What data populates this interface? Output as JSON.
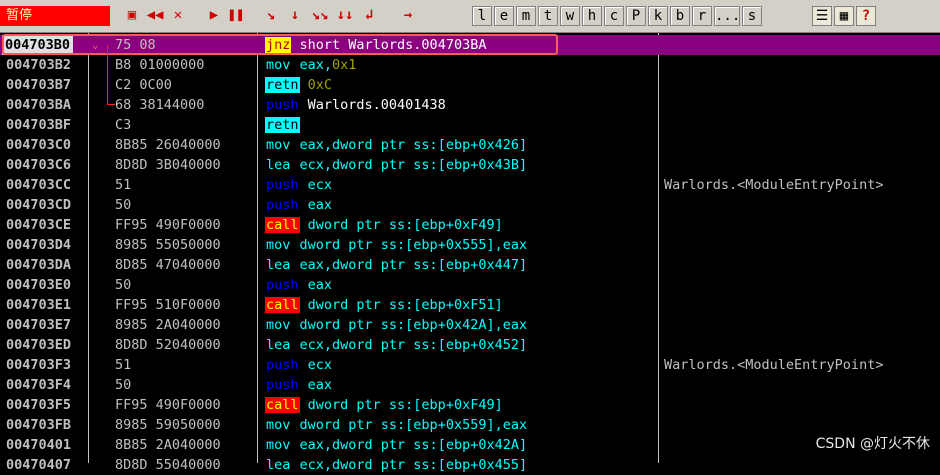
{
  "status": "暂停",
  "toolbar": {
    "buttons": [
      {
        "label": "▣",
        "name": "open-icon"
      },
      {
        "label": "◀◀",
        "name": "restart-icon"
      },
      {
        "label": "✕",
        "name": "close-icon"
      },
      {
        "label": "▶",
        "name": "run-icon"
      },
      {
        "label": "❚❚",
        "name": "pause-icon"
      },
      {
        "label": "↘",
        "name": "step-into-icon"
      },
      {
        "label": "↓",
        "name": "step-over-icon"
      },
      {
        "label": "↘↘",
        "name": "trace-into-icon"
      },
      {
        "label": "↓↓",
        "name": "trace-over-icon"
      },
      {
        "label": "↲",
        "name": "execute-till-return-icon"
      },
      {
        "label": "→",
        "name": "goto-icon"
      }
    ],
    "letters": [
      "l",
      "e",
      "m",
      "t",
      "w",
      "h",
      "c",
      "P",
      "k",
      "b",
      "r",
      "...",
      "s"
    ],
    "right_icons": [
      {
        "label": "☰",
        "name": "list-icon"
      },
      {
        "label": "▦",
        "name": "grid-icon"
      },
      {
        "label": "?",
        "name": "help-icon"
      }
    ]
  },
  "rows": [
    {
      "addr": "004703B0",
      "marker": "⌄",
      "hex": "75 08",
      "mn": "jnz",
      "mt": "jmp",
      "ops": [
        {
          "t": " short Warlords.004703BA",
          "c": "op-w"
        }
      ],
      "cmt": "",
      "sel": true
    },
    {
      "addr": "004703B2",
      "hex": "B8 01000000",
      "mn": "mov",
      "mt": "plain",
      "ops": [
        {
          "t": " eax,",
          "c": "op"
        },
        {
          "t": "0x1",
          "c": "imm"
        }
      ],
      "cmt": ""
    },
    {
      "addr": "004703B7",
      "hex": "C2 0C00",
      "mn": "retn",
      "mt": "retn",
      "ops": [
        {
          "t": " 0xC",
          "c": "imm"
        }
      ],
      "cmt": ""
    },
    {
      "addr": "004703BA",
      "hex": "68 38144000",
      "mn": "push",
      "mt": "push",
      "ops": [
        {
          "t": " Warlords.00401438",
          "c": "op-w"
        }
      ],
      "cmt": ""
    },
    {
      "addr": "004703BF",
      "hex": "C3",
      "mn": "retn",
      "mt": "retn",
      "ops": [],
      "cmt": ""
    },
    {
      "addr": "004703C0",
      "hex": "8B85 26040000",
      "mn": "mov",
      "mt": "plain",
      "ops": [
        {
          "t": " eax,dword ptr ss:[ebp+0x426]",
          "c": "op"
        }
      ],
      "cmt": ""
    },
    {
      "addr": "004703C6",
      "hex": "8D8D 3B040000",
      "mn": "lea",
      "mt": "plain",
      "ops": [
        {
          "t": " ecx,dword ptr ss:[ebp+0x43B]",
          "c": "op"
        }
      ],
      "cmt": ""
    },
    {
      "addr": "004703CC",
      "hex": "51",
      "mn": "push",
      "mt": "push",
      "ops": [
        {
          "t": " ecx",
          "c": "op"
        }
      ],
      "cmt": "Warlords.<ModuleEntryPoint>"
    },
    {
      "addr": "004703CD",
      "hex": "50",
      "mn": "push",
      "mt": "push",
      "ops": [
        {
          "t": " eax",
          "c": "op"
        }
      ],
      "cmt": ""
    },
    {
      "addr": "004703CE",
      "hex": "FF95 490F0000",
      "mn": "call",
      "mt": "call",
      "ops": [
        {
          "t": " dword ptr ss:[ebp+0xF49]",
          "c": "op"
        }
      ],
      "cmt": ""
    },
    {
      "addr": "004703D4",
      "hex": "8985 55050000",
      "mn": "mov",
      "mt": "plain",
      "ops": [
        {
          "t": " dword ptr ss:[ebp+0x555],eax",
          "c": "op"
        }
      ],
      "cmt": ""
    },
    {
      "addr": "004703DA",
      "hex": "8D85 47040000",
      "mn": "lea",
      "mt": "plain",
      "ops": [
        {
          "t": " eax,dword ptr ss:[ebp+0x447]",
          "c": "op"
        }
      ],
      "cmt": ""
    },
    {
      "addr": "004703E0",
      "hex": "50",
      "mn": "push",
      "mt": "push",
      "ops": [
        {
          "t": " eax",
          "c": "op"
        }
      ],
      "cmt": ""
    },
    {
      "addr": "004703E1",
      "hex": "FF95 510F0000",
      "mn": "call",
      "mt": "call",
      "ops": [
        {
          "t": " dword ptr ss:[ebp+0xF51]",
          "c": "op"
        }
      ],
      "cmt": ""
    },
    {
      "addr": "004703E7",
      "hex": "8985 2A040000",
      "mn": "mov",
      "mt": "plain",
      "ops": [
        {
          "t": " dword ptr ss:[ebp+0x42A],eax",
          "c": "op"
        }
      ],
      "cmt": ""
    },
    {
      "addr": "004703ED",
      "hex": "8D8D 52040000",
      "mn": "lea",
      "mt": "plain",
      "ops": [
        {
          "t": " ecx,dword ptr ss:[ebp+0x452]",
          "c": "op"
        }
      ],
      "cmt": ""
    },
    {
      "addr": "004703F3",
      "hex": "51",
      "mn": "push",
      "mt": "push",
      "ops": [
        {
          "t": " ecx",
          "c": "op"
        }
      ],
      "cmt": "Warlords.<ModuleEntryPoint>"
    },
    {
      "addr": "004703F4",
      "hex": "50",
      "mn": "push",
      "mt": "push",
      "ops": [
        {
          "t": " eax",
          "c": "op"
        }
      ],
      "cmt": ""
    },
    {
      "addr": "004703F5",
      "hex": "FF95 490F0000",
      "mn": "call",
      "mt": "call",
      "ops": [
        {
          "t": " dword ptr ss:[ebp+0xF49]",
          "c": "op"
        }
      ],
      "cmt": ""
    },
    {
      "addr": "004703FB",
      "hex": "8985 59050000",
      "mn": "mov",
      "mt": "plain",
      "ops": [
        {
          "t": " dword ptr ss:[ebp+0x559],eax",
          "c": "op"
        }
      ],
      "cmt": ""
    },
    {
      "addr": "00470401",
      "hex": "8B85 2A040000",
      "mn": "mov",
      "mt": "plain",
      "ops": [
        {
          "t": " eax,dword ptr ss:[ebp+0x42A]",
          "c": "op"
        }
      ],
      "cmt": ""
    },
    {
      "addr": "00470407",
      "hex": "8D8D 55040000",
      "mn": "lea",
      "mt": "plain",
      "ops": [
        {
          "t": " ecx,dword ptr ss:[ebp+0x455]",
          "c": "op"
        }
      ],
      "cmt": ""
    }
  ],
  "watermark": "CSDN @灯火不休"
}
